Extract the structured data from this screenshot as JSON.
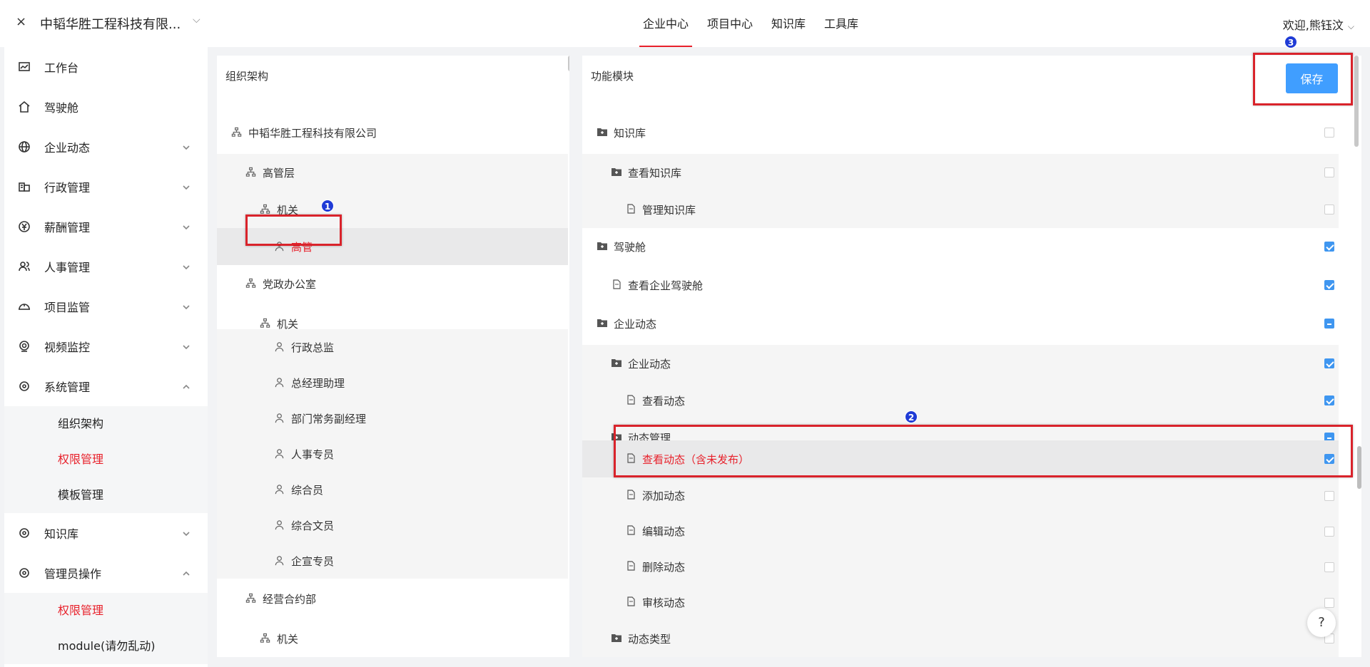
{
  "header": {
    "close": "×",
    "company": "中韬华胜工程科技有限...",
    "tabs": [
      "企业中心",
      "项目中心",
      "知识库",
      "工具库"
    ],
    "active_tab": "企业中心",
    "welcome": "欢迎,熊钰汶"
  },
  "sidebar": {
    "items": [
      {
        "label": "工作台",
        "icon": "chart-icon"
      },
      {
        "label": "驾驶舱",
        "icon": "home-icon"
      },
      {
        "label": "企业动态",
        "icon": "globe-icon"
      },
      {
        "label": "行政管理",
        "icon": "building-icon"
      },
      {
        "label": "薪酬管理",
        "icon": "money-icon"
      },
      {
        "label": "人事管理",
        "icon": "people-icon"
      },
      {
        "label": "项目监管",
        "icon": "helmet-icon"
      },
      {
        "label": "视频监控",
        "icon": "camera-icon"
      },
      {
        "label": "系统管理",
        "icon": "circle-icon"
      }
    ],
    "system_sub": [
      "组织架构",
      "权限管理",
      "模板管理"
    ],
    "items2": [
      {
        "label": "知识库",
        "icon": "circle-icon"
      },
      {
        "label": "管理员操作",
        "icon": "circle-icon"
      }
    ],
    "admin_sub": [
      "权限管理",
      "module(请勿乱动)"
    ]
  },
  "org": {
    "title": "组织架构",
    "nodes": [
      "中韬华胜工程科技有限公司",
      "高管层",
      "机关",
      "高管",
      "党政办公室",
      "机关",
      "行政总监",
      "总经理助理",
      "部门常务副经理",
      "人事专员",
      "综合员",
      "综合文员",
      "企宣专员",
      "经营合约部",
      "机关"
    ]
  },
  "modules": {
    "title": "功能模块",
    "save": "保存",
    "rows": [
      {
        "label": "知识库",
        "state": "off"
      },
      {
        "label": "查看知识库",
        "state": "off"
      },
      {
        "label": "管理知识库",
        "state": "off"
      },
      {
        "label": "驾驶舱",
        "state": "on"
      },
      {
        "label": "查看企业驾驶舱",
        "state": "on"
      },
      {
        "label": "企业动态",
        "state": "ind"
      },
      {
        "label": "企业动态",
        "state": "on"
      },
      {
        "label": "查看动态",
        "state": "on"
      },
      {
        "label": "动态管理",
        "state": "ind"
      },
      {
        "label": "查看动态（含未发布）",
        "state": "on"
      },
      {
        "label": "添加动态",
        "state": "off"
      },
      {
        "label": "编辑动态",
        "state": "off"
      },
      {
        "label": "删除动态",
        "state": "off"
      },
      {
        "label": "审核动态",
        "state": "off"
      },
      {
        "label": "动态类型",
        "state": "off"
      }
    ]
  },
  "annotations": [
    "1",
    "2",
    "3"
  ],
  "help": "?",
  "colors": {
    "accent_red": "#e8212b",
    "primary_blue": "#409eff",
    "annotation_box": "#d9232b"
  }
}
